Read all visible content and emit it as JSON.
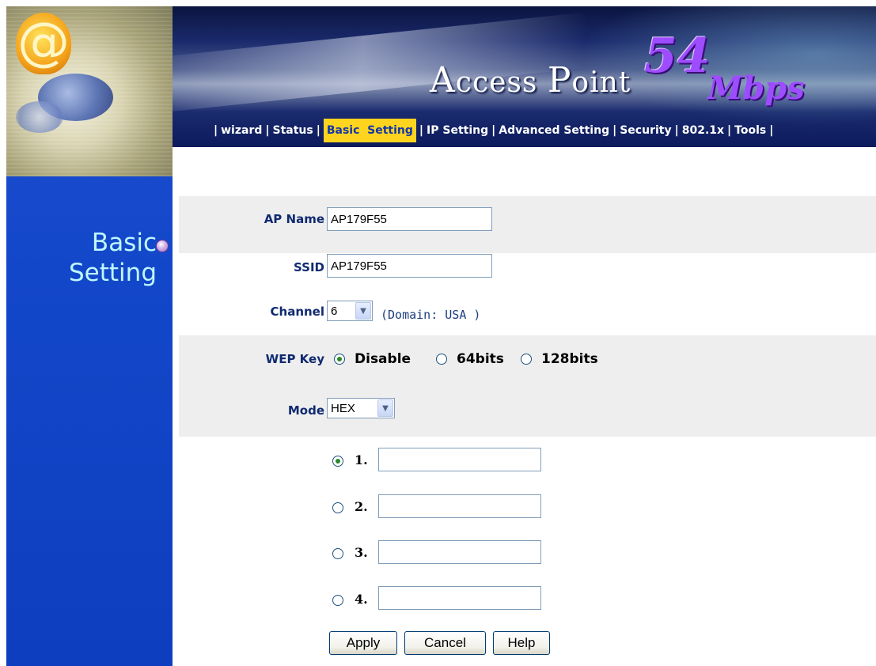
{
  "sidebar": {
    "logo_glyph": "@",
    "title_line1": "Basic",
    "title_line2": "Setting",
    "bullet_icon": "bullet-circle-icon"
  },
  "banner": {
    "title_a": "A",
    "title_rest1": "ccess ",
    "title_p": "P",
    "title_rest2": "oint",
    "speed": "54",
    "unit": "Mbps"
  },
  "nav": {
    "items": [
      {
        "label": "wizard",
        "active": false
      },
      {
        "label": "Status",
        "active": false
      },
      {
        "label": "Basic  Setting",
        "active": true
      },
      {
        "label": "IP Setting",
        "active": false
      },
      {
        "label": "Advanced Setting",
        "active": false
      },
      {
        "label": "Security",
        "active": false
      },
      {
        "label": "802.1x",
        "active": false
      },
      {
        "label": "Tools",
        "active": false
      }
    ],
    "separator": "|",
    "active_bg": "#ffd41e"
  },
  "form": {
    "ap_name": {
      "label": "AP Name",
      "value": "AP179F55"
    },
    "ssid": {
      "label": "SSID",
      "value": "AP179F55"
    },
    "channel": {
      "label": "Channel",
      "value": "6",
      "domain_note": "(Domain: USA )"
    },
    "wep_key": {
      "label": "WEP Key",
      "options": [
        {
          "label": "Disable",
          "selected": true
        },
        {
          "label": "64bits",
          "selected": false
        },
        {
          "label": "128bits",
          "selected": false
        }
      ]
    },
    "mode": {
      "label": "Mode",
      "value": "HEX"
    },
    "keys": [
      {
        "num": "1.",
        "selected": true,
        "value": ""
      },
      {
        "num": "2.",
        "selected": false,
        "value": ""
      },
      {
        "num": "3.",
        "selected": false,
        "value": ""
      },
      {
        "num": "4.",
        "selected": false,
        "value": ""
      }
    ]
  },
  "buttons": {
    "apply": "Apply",
    "cancel": "Cancel",
    "help": "Help"
  },
  "colors": {
    "sidebar_blue": "#1347c9",
    "sidebar_title": "#bff7ff",
    "band_gray": "#eeeeee",
    "label_blue": "#102a70",
    "speed_purple": "#9d4dff"
  }
}
